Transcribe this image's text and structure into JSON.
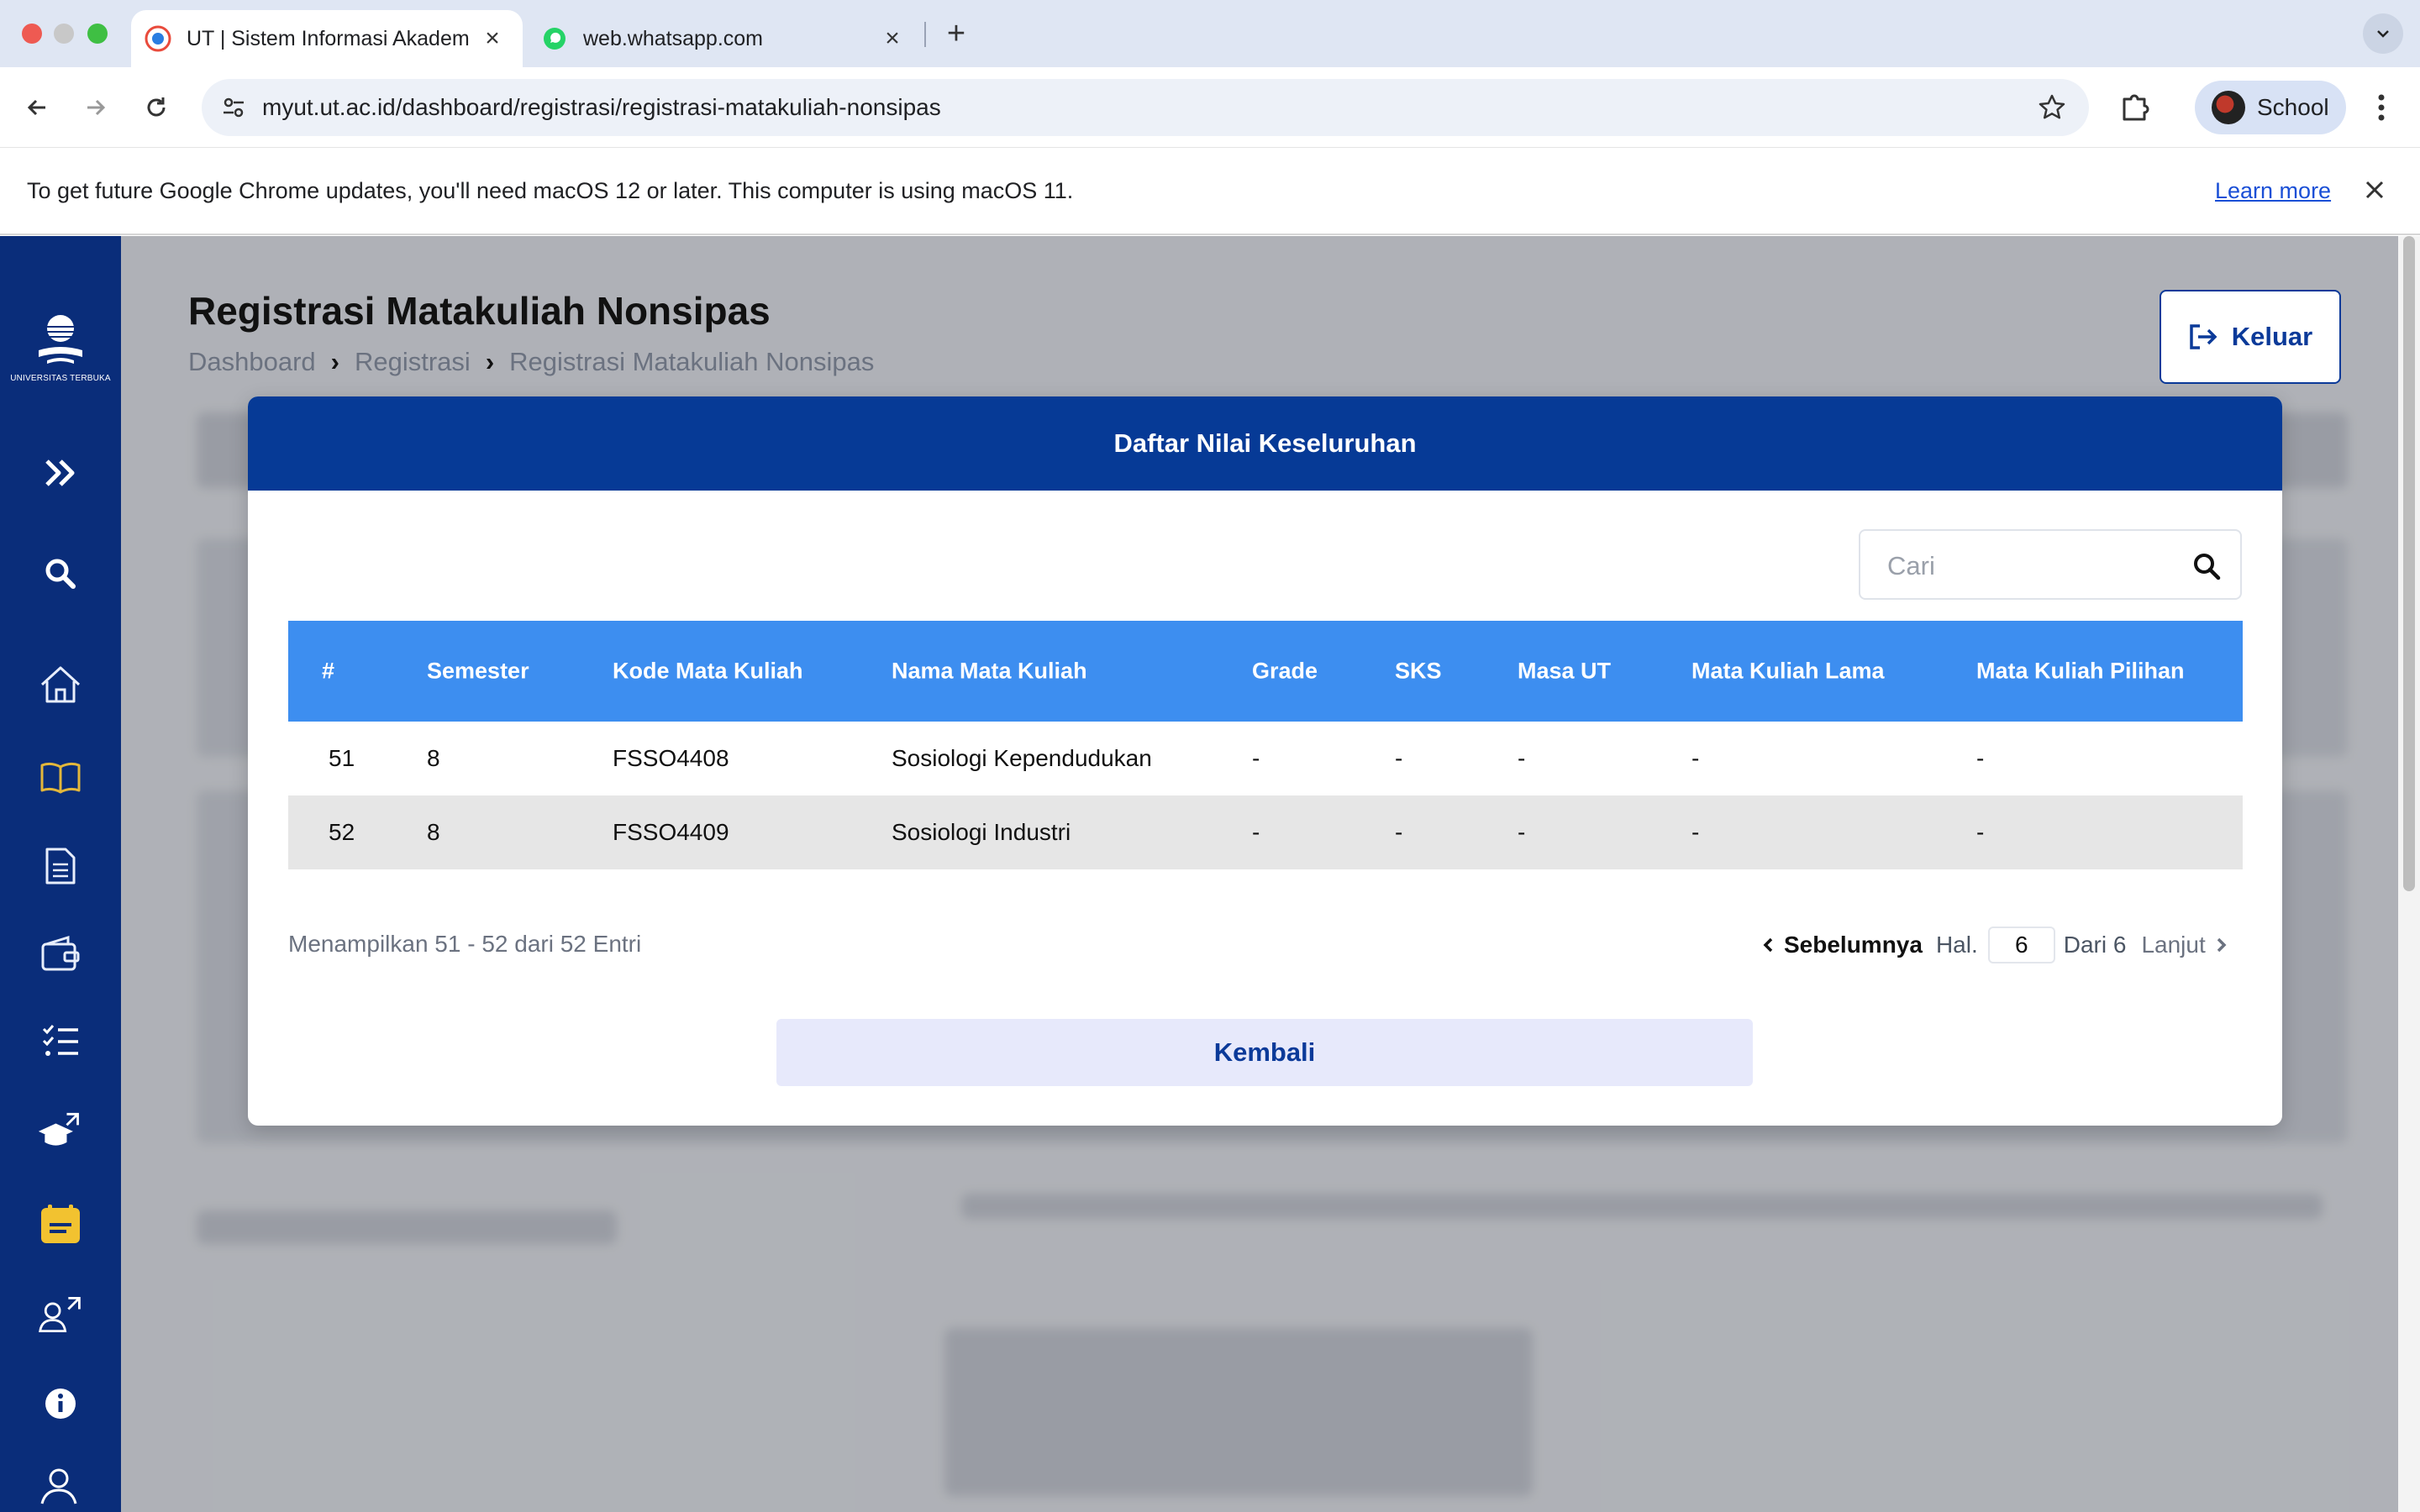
{
  "browser": {
    "tabs": [
      {
        "title": "UT | Sistem Informasi Akadem",
        "active": true
      },
      {
        "title": "web.whatsapp.com",
        "active": false
      }
    ],
    "url": "myut.ut.ac.id/dashboard/registrasi/registrasi-matakuliah-nonsipas",
    "profile_name": "School"
  },
  "infobar": {
    "message": "To get future Google Chrome updates, you'll need macOS 12 or later. This computer is using macOS 11.",
    "link": "Learn more"
  },
  "sidebar": {
    "logo_text": "UNIVERSITAS TERBUKA",
    "icons": [
      "expand-icon",
      "search-icon",
      "home-icon",
      "book-icon",
      "document-icon",
      "wallet-icon",
      "checklist-icon",
      "graduation-external-icon",
      "calendar-icon",
      "users-external-icon",
      "info-icon",
      "user-icon"
    ]
  },
  "page": {
    "title": "Registrasi Matakuliah Nonsipas",
    "breadcrumb": [
      "Dashboard",
      "Registrasi",
      "Registrasi Matakuliah Nonsipas"
    ],
    "logout_label": "Keluar"
  },
  "modal": {
    "title": "Daftar Nilai Keseluruhan",
    "search_placeholder": "Cari",
    "columns": [
      "#",
      "Semester",
      "Kode Mata Kuliah",
      "Nama Mata Kuliah",
      "Grade",
      "SKS",
      "Masa UT",
      "Mata Kuliah Lama",
      "Mata Kuliah Pilihan"
    ],
    "rows": [
      [
        "51",
        "8",
        "FSSO4408",
        "Sosiologi Kependudukan",
        "-",
        "-",
        "-",
        "-",
        "-"
      ],
      [
        "52",
        "8",
        "FSSO4409",
        "Sosiologi Industri",
        "-",
        "-",
        "-",
        "-",
        "-"
      ]
    ],
    "entries_text": "Menampilkan 51 - 52 dari 52 Entri",
    "pagination": {
      "prev_label": "Sebelumnya",
      "page_prefix": "Hal.",
      "current_page": "6",
      "total_text": "Dari 6",
      "next_label": "Lanjut"
    },
    "back_label": "Kembali"
  }
}
